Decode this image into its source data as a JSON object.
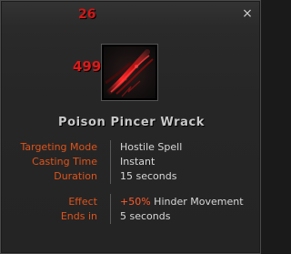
{
  "floating_damage": {
    "small": "26",
    "big": "499"
  },
  "tooltip": {
    "close_symbol": "×",
    "icon": "poison-pincer-wrack-icon",
    "title": "Poison Pincer Wrack",
    "rows": [
      {
        "label": "Targeting Mode",
        "value": "Hostile Spell"
      },
      {
        "label": "Casting Time",
        "value": "Instant"
      },
      {
        "label": "Duration",
        "value": "15 seconds"
      },
      {
        "label": "Effect",
        "value_accent": "+50%",
        "value": " Hinder Movement"
      },
      {
        "label": "Ends in",
        "value": "5 seconds"
      }
    ]
  },
  "colors": {
    "label": "#e0541a",
    "value": "#d8d8d8",
    "accent": "#ff5a2a",
    "damage": "#e01818",
    "title": "#c9c9c9"
  }
}
